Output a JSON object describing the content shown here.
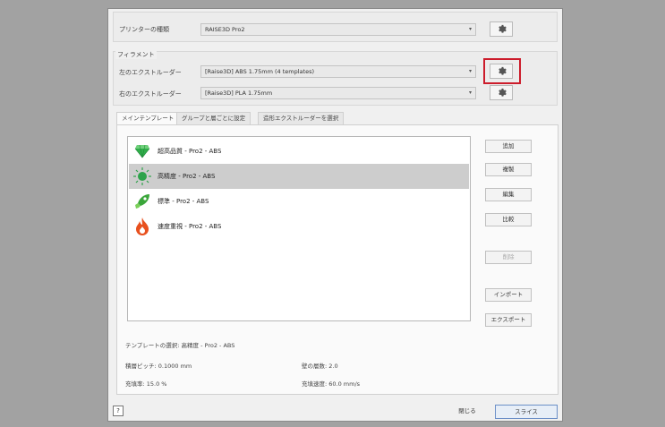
{
  "printer": {
    "label": "プリンターの種類",
    "value": "RAISE3D Pro2"
  },
  "filament": {
    "group_title": "フィラメント",
    "left": {
      "label": "左のエクストルーダー",
      "value": "[Raise3D] ABS 1.75mm (4 templates)"
    },
    "right": {
      "label": "右のエクストルーダー",
      "value": "[Raise3D] PLA 1.75mm"
    }
  },
  "tabs": [
    {
      "label": "メインテンプレート",
      "active": true
    },
    {
      "label": "グループと層ごとに設定",
      "active": false
    },
    {
      "label": "造形エクストルーダーを選択",
      "active": false
    }
  ],
  "templates": [
    {
      "name": "超高品質 - Pro2 - ABS",
      "icon": "diamond-icon",
      "selected": false
    },
    {
      "name": "高精度 - Pro2 - ABS",
      "icon": "sparkle-icon",
      "selected": true
    },
    {
      "name": "標準 - Pro2 - ABS",
      "icon": "rocket-icon",
      "selected": false
    },
    {
      "name": "速度重視 - Pro2 - ABS",
      "icon": "flame-icon",
      "selected": false
    }
  ],
  "side_buttons": {
    "add": "追加",
    "copy": "複製",
    "edit": "編集",
    "compare": "比較",
    "delete": "削除",
    "import": "インポート",
    "export": "エクスポート"
  },
  "info": {
    "selected": "テンプレートの選択: 高精度 - Pro2 - ABS",
    "layer_pitch": "積層ピッチ: 0.1000 mm",
    "wall_count": "壁の層数: 2.0",
    "infill_rate": "充填率: 15.0 %",
    "infill_speed": "充填速度: 60.0 mm/s"
  },
  "footer": {
    "help": "?",
    "close": "閉じる",
    "slice": "スライス"
  },
  "colors": {
    "highlight": "#cc1c2b",
    "diamond": "#2fae4a",
    "sparkle": "#2ea34b",
    "rocket": "#3aa63a",
    "flame": "#e8501e"
  }
}
